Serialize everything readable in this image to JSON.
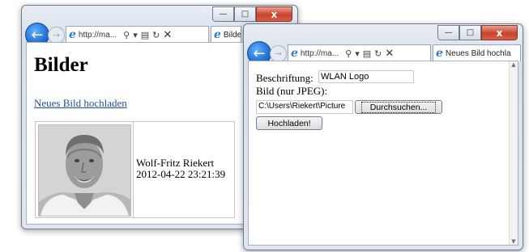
{
  "window1": {
    "address": "http://ma...",
    "tab_label": "Bilde",
    "page": {
      "title": "Bilder",
      "upload_link": "Neues Bild hochladen",
      "image": {
        "author": "Wolf-Fritz Riekert",
        "timestamp": "2012-04-22 23:21:39"
      }
    }
  },
  "window2": {
    "address": "http://ma...",
    "tab_label": "Neues Bild hochla",
    "form": {
      "caption_label": "Beschriftung:",
      "caption_value": "WLAN Logo",
      "image_label": "Bild (nur JPEG):",
      "file_path": "C:\\Users\\Riekert\\Picture",
      "browse_button": "Durchsuchen...",
      "upload_button": "Hochladen!"
    }
  },
  "controls": {
    "minimize": "—",
    "maximize": "□",
    "close": "x",
    "back": "←",
    "forward": "→"
  },
  "colors": {
    "accent": "#1a64c8",
    "link": "#1f4f9a",
    "close": "#c8432b"
  }
}
